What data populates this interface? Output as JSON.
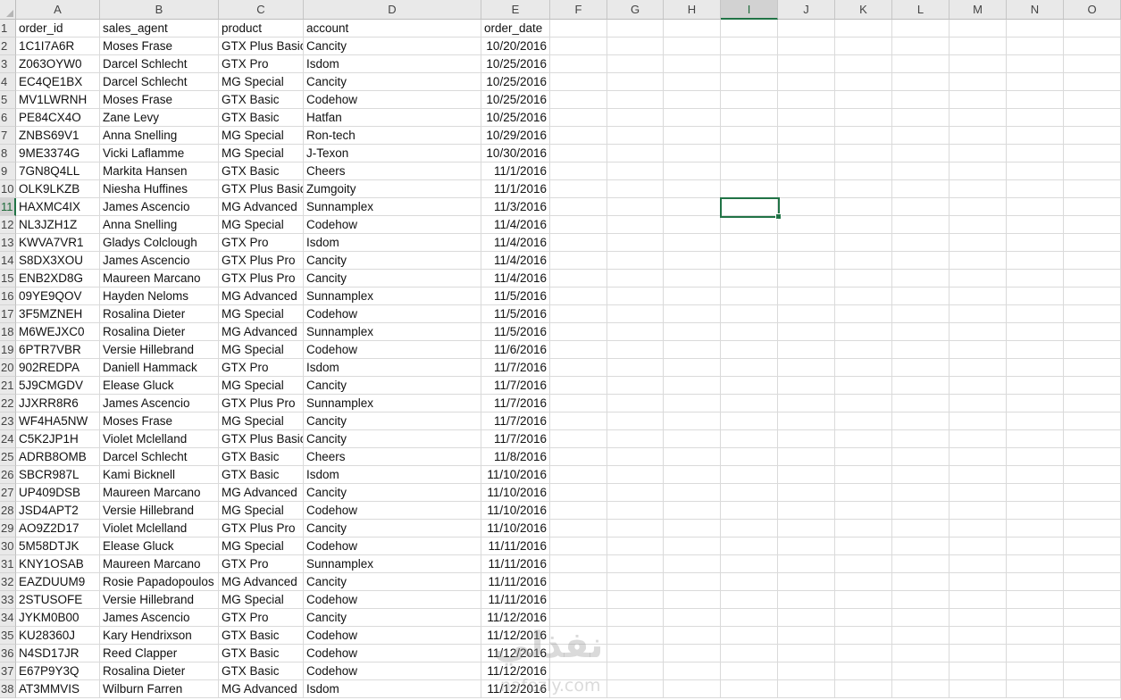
{
  "columns": [
    "A",
    "B",
    "C",
    "D",
    "E",
    "F",
    "G",
    "H",
    "I",
    "J",
    "K",
    "L",
    "M",
    "N",
    "O"
  ],
  "selected_cell": {
    "col": "I",
    "row": 11
  },
  "header_row": [
    "order_id",
    "sales_agent",
    "product",
    "account",
    "order_date"
  ],
  "rows": [
    [
      "1C1I7A6R",
      "Moses Frase",
      "GTX Plus Basic",
      "Cancity",
      "10/20/2016"
    ],
    [
      "Z063OYW0",
      "Darcel Schlecht",
      "GTX Pro",
      "Isdom",
      "10/25/2016"
    ],
    [
      "EC4QE1BX",
      "Darcel Schlecht",
      "MG Special",
      "Cancity",
      "10/25/2016"
    ],
    [
      "MV1LWRNH",
      "Moses Frase",
      "GTX Basic",
      "Codehow",
      "10/25/2016"
    ],
    [
      "PE84CX4O",
      "Zane Levy",
      "GTX Basic",
      "Hatfan",
      "10/25/2016"
    ],
    [
      "ZNBS69V1",
      "Anna Snelling",
      "MG Special",
      "Ron-tech",
      "10/29/2016"
    ],
    [
      "9ME3374G",
      "Vicki Laflamme",
      "MG Special",
      "J-Texon",
      "10/30/2016"
    ],
    [
      "7GN8Q4LL",
      "Markita Hansen",
      "GTX Basic",
      "Cheers",
      "11/1/2016"
    ],
    [
      "OLK9LKZB",
      "Niesha Huffines",
      "GTX Plus Basic",
      "Zumgoity",
      "11/1/2016"
    ],
    [
      "HAXMC4IX",
      "James Ascencio",
      "MG Advanced",
      "Sunnamplex",
      "11/3/2016"
    ],
    [
      "NL3JZH1Z",
      "Anna Snelling",
      "MG Special",
      "Codehow",
      "11/4/2016"
    ],
    [
      "KWVA7VR1",
      "Gladys Colclough",
      "GTX Pro",
      "Isdom",
      "11/4/2016"
    ],
    [
      "S8DX3XOU",
      "James Ascencio",
      "GTX Plus Pro",
      "Cancity",
      "11/4/2016"
    ],
    [
      "ENB2XD8G",
      "Maureen Marcano",
      "GTX Plus Pro",
      "Cancity",
      "11/4/2016"
    ],
    [
      "09YE9QOV",
      "Hayden Neloms",
      "MG Advanced",
      "Sunnamplex",
      "11/5/2016"
    ],
    [
      "3F5MZNEH",
      "Rosalina Dieter",
      "MG Special",
      "Codehow",
      "11/5/2016"
    ],
    [
      "M6WEJXC0",
      "Rosalina Dieter",
      "MG Advanced",
      "Sunnamplex",
      "11/5/2016"
    ],
    [
      "6PTR7VBR",
      "Versie Hillebrand",
      "MG Special",
      "Codehow",
      "11/6/2016"
    ],
    [
      "902REDPA",
      "Daniell Hammack",
      "GTX Pro",
      "Isdom",
      "11/7/2016"
    ],
    [
      "5J9CMGDV",
      "Elease Gluck",
      "MG Special",
      "Cancity",
      "11/7/2016"
    ],
    [
      "JJXRR8R6",
      "James Ascencio",
      "GTX Plus Pro",
      "Sunnamplex",
      "11/7/2016"
    ],
    [
      "WF4HA5NW",
      "Moses Frase",
      "MG Special",
      "Cancity",
      "11/7/2016"
    ],
    [
      "C5K2JP1H",
      "Violet Mclelland",
      "GTX Plus Basic",
      "Cancity",
      "11/7/2016"
    ],
    [
      "ADRB8OMB",
      "Darcel Schlecht",
      "GTX Basic",
      "Cheers",
      "11/8/2016"
    ],
    [
      "SBCR987L",
      "Kami Bicknell",
      "GTX Basic",
      "Isdom",
      "11/10/2016"
    ],
    [
      "UP409DSB",
      "Maureen Marcano",
      "MG Advanced",
      "Cancity",
      "11/10/2016"
    ],
    [
      "JSD4APT2",
      "Versie Hillebrand",
      "MG Special",
      "Codehow",
      "11/10/2016"
    ],
    [
      "AO9Z2D17",
      "Violet Mclelland",
      "GTX Plus Pro",
      "Cancity",
      "11/10/2016"
    ],
    [
      "5M58DTJK",
      "Elease Gluck",
      "MG Special",
      "Codehow",
      "11/11/2016"
    ],
    [
      "KNY1OSAB",
      "Maureen Marcano",
      "GTX Pro",
      "Sunnamplex",
      "11/11/2016"
    ],
    [
      "EAZDUUM9",
      "Rosie Papadopoulos",
      "MG Advanced",
      "Cancity",
      "11/11/2016"
    ],
    [
      "2STUSOFE",
      "Versie Hillebrand",
      "MG Special",
      "Codehow",
      "11/11/2016"
    ],
    [
      "JYKM0B00",
      "James Ascencio",
      "GTX Pro",
      "Cancity",
      "11/12/2016"
    ],
    [
      "KU28360J",
      "Kary Hendrixson",
      "GTX Basic",
      "Codehow",
      "11/12/2016"
    ],
    [
      "N4SD17JR",
      "Reed Clapper",
      "GTX Basic",
      "Codehow",
      "11/12/2016"
    ],
    [
      "E67P9Y3Q",
      "Rosalina Dieter",
      "GTX Basic",
      "Codehow",
      "11/12/2016"
    ],
    [
      "AT3MMVIS",
      "Wilburn Farren",
      "MG Advanced",
      "Isdom",
      "11/12/2016"
    ]
  ],
  "watermark": {
    "logo_text": "نفذلي",
    "url_text": "nafezly.com"
  }
}
